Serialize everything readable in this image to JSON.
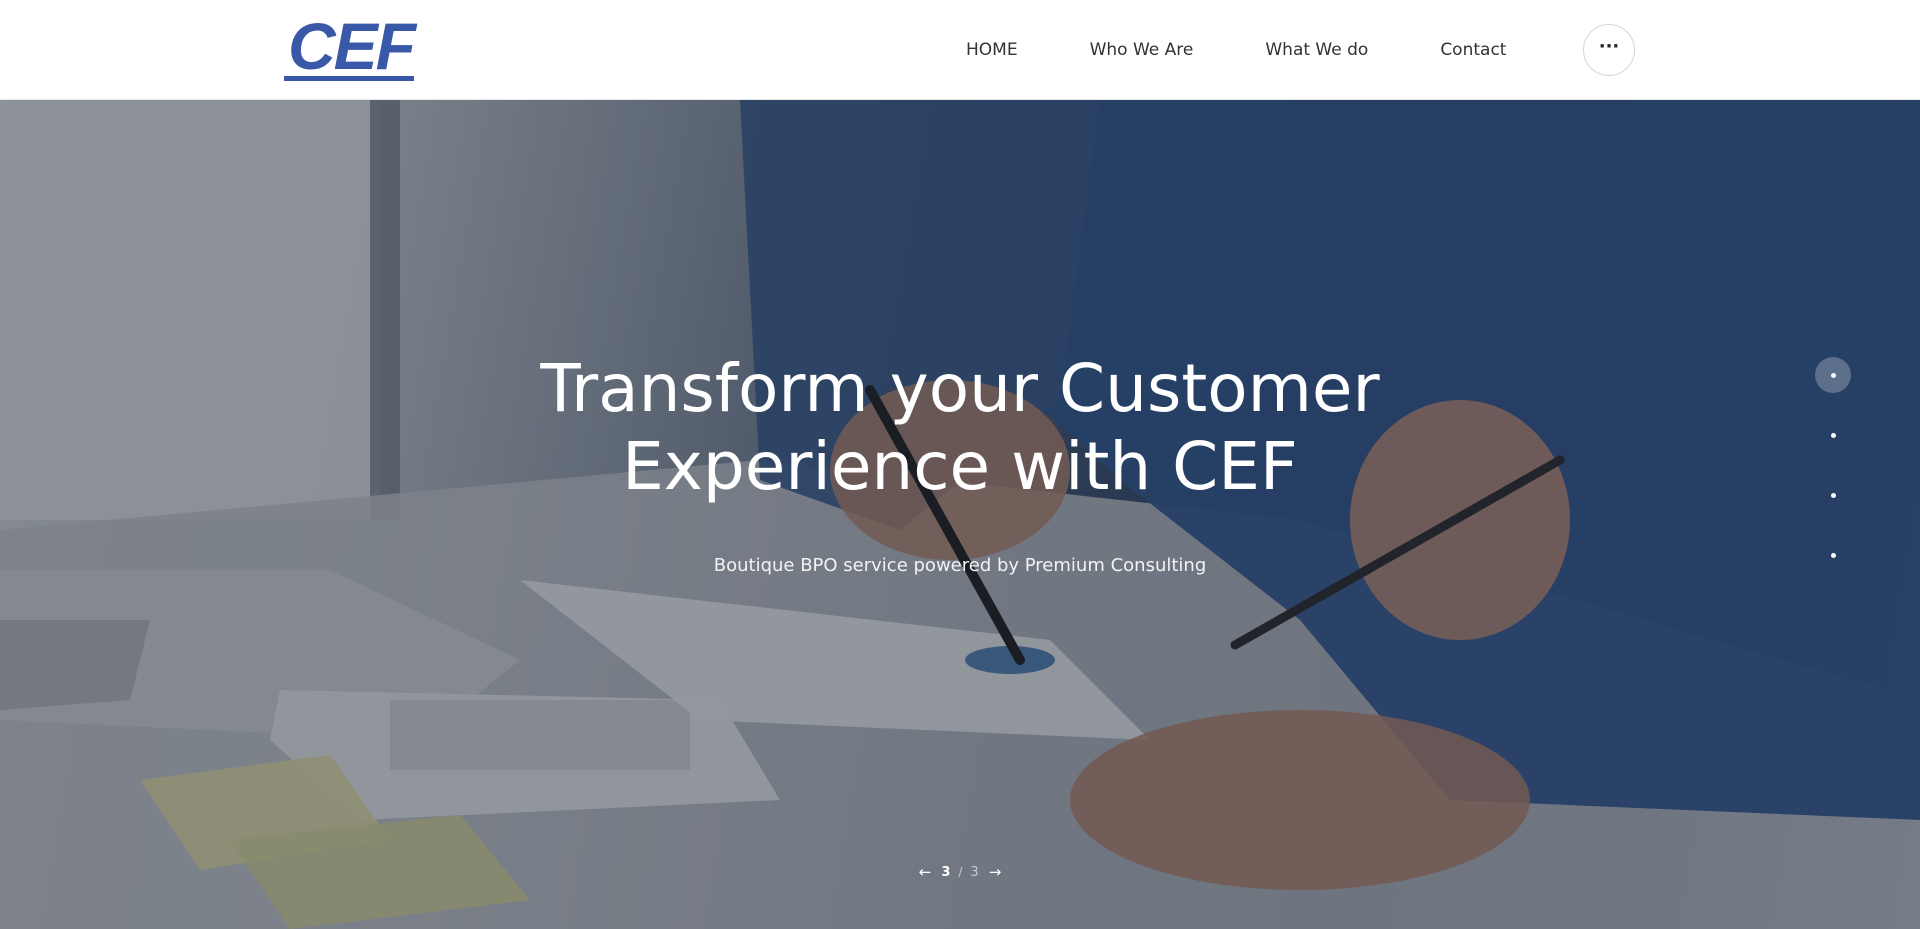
{
  "brand": {
    "logo_text": "CEF",
    "logo_color": "#3a58a8"
  },
  "nav": {
    "items": [
      {
        "label": "HOME"
      },
      {
        "label": "Who We Are"
      },
      {
        "label": "What We do"
      },
      {
        "label": "Contact"
      }
    ],
    "more_icon": "ellipsis-icon"
  },
  "hero": {
    "title_line1": "Transform your Customer",
    "title_line2": "Experience with CEF",
    "subtitle": "Boutique BPO service powered by Premium Consulting",
    "pager": {
      "current": "3",
      "separator": "/",
      "total": "3"
    },
    "side_dots": {
      "count": 4,
      "active_index": 0
    }
  }
}
